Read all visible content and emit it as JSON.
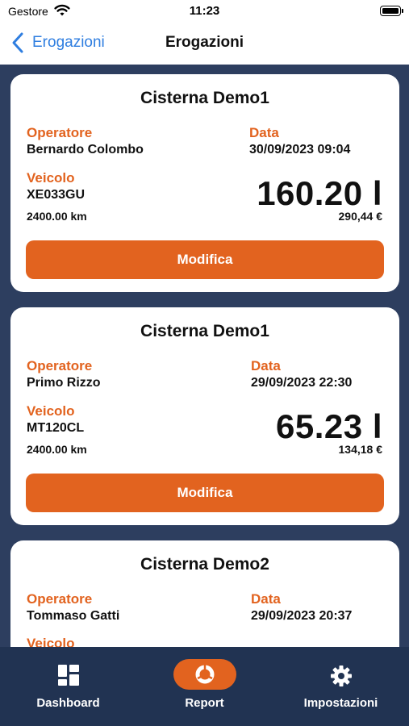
{
  "status_bar": {
    "carrier": "Gestore",
    "time": "11:23"
  },
  "nav": {
    "back_label": "Erogazioni",
    "title": "Erogazioni"
  },
  "labels": {
    "operator": "Operatore",
    "date": "Data",
    "vehicle": "Veicolo",
    "edit_button": "Modifica"
  },
  "cards": [
    {
      "title": "Cisterna Demo1",
      "operator": "Bernardo Colombo",
      "date": "30/09/2023 09:04",
      "plate": "XE033GU",
      "km": "2400.00 km",
      "liters": "160.20 l",
      "price": "290,44 €"
    },
    {
      "title": "Cisterna Demo1",
      "operator": "Primo Rizzo",
      "date": "29/09/2023 22:30",
      "plate": "MT120CL",
      "km": "2400.00 km",
      "liters": "65.23 l",
      "price": "134,18 €"
    },
    {
      "title": "Cisterna Demo2",
      "operator": "Tommaso Gatti",
      "date": "29/09/2023 20:37",
      "plate": "",
      "km": "",
      "liters": "",
      "price": ""
    }
  ],
  "tabs": [
    {
      "label": "Dashboard",
      "icon": "dashboard-grid-icon",
      "active": false
    },
    {
      "label": "Report",
      "icon": "report-pie-icon",
      "active": true
    },
    {
      "label": "Impostazioni",
      "icon": "settings-gear-icon",
      "active": false
    }
  ],
  "colors": {
    "accent": "#e2631f",
    "link": "#2f7ee0",
    "content_bg": "#2d3e5f",
    "tabbar_bg": "#213352",
    "card_bg": "#ffffff"
  }
}
